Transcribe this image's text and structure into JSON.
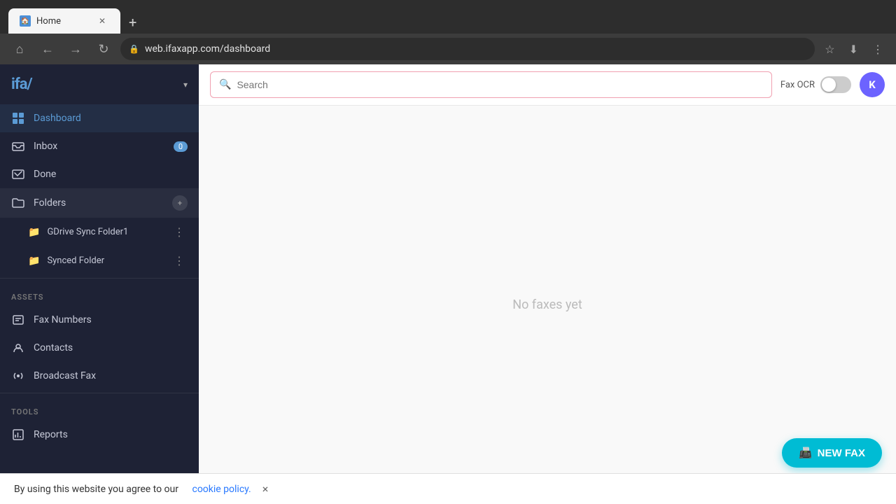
{
  "browser": {
    "tab_title": "Home",
    "tab_favicon": "🏠",
    "url": "web.ifaxapp.com/dashboard",
    "add_tab_icon": "+",
    "nav_back": "←",
    "nav_forward": "→",
    "nav_reload": "↻",
    "nav_home": "⌂",
    "lock_icon": "🔒",
    "star_icon": "★",
    "download_icon": "⬇",
    "menu_icon": "⋮"
  },
  "sidebar": {
    "logo": "ifax",
    "logo_accent": "/",
    "chevron": "▾",
    "nav_items": [
      {
        "id": "dashboard",
        "label": "Dashboard",
        "icon": "⊡",
        "active": true
      },
      {
        "id": "inbox",
        "label": "Inbox",
        "icon": "⬛",
        "badge": "0"
      },
      {
        "id": "done",
        "label": "Done",
        "icon": "✉"
      },
      {
        "id": "folders",
        "label": "Folders",
        "icon": "📁",
        "folder_btn": "+"
      }
    ],
    "folders": [
      {
        "id": "gdrive-sync",
        "name": "GDrive Sync Folder1"
      },
      {
        "id": "synced",
        "name": "Synced Folder"
      }
    ],
    "assets_label": "ASSETS",
    "assets_items": [
      {
        "id": "fax-numbers",
        "label": "Fax Numbers",
        "icon": "#"
      },
      {
        "id": "contacts",
        "label": "Contacts",
        "icon": "👤"
      },
      {
        "id": "broadcast-fax",
        "label": "Broadcast Fax",
        "icon": "📢"
      }
    ],
    "tools_label": "TOOLS",
    "tools_items": [
      {
        "id": "reports",
        "label": "Reports",
        "icon": "📊"
      }
    ]
  },
  "toolbar": {
    "search_placeholder": "Search",
    "ocr_label": "Fax OCR",
    "ocr_state": false,
    "user_initial": "K"
  },
  "main": {
    "empty_message": "No faxes yet"
  },
  "cookie": {
    "text": "By using this website you agree to our",
    "link_text": "cookie policy.",
    "close_icon": "×"
  },
  "new_fax": {
    "icon": "📠",
    "label": "NEW FAX"
  }
}
